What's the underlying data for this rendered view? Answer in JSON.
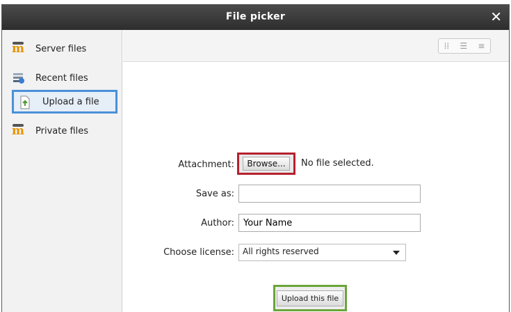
{
  "window": {
    "title": "File picker",
    "close": "✕"
  },
  "sidebar": {
    "items": [
      {
        "label": "Server files",
        "icon": "moodle-icon"
      },
      {
        "label": "Recent files",
        "icon": "recent-files-icon"
      },
      {
        "label": "Upload a file",
        "icon": "upload-icon",
        "selected": true
      },
      {
        "label": "Private files",
        "icon": "moodle-icon"
      }
    ]
  },
  "toolbar": {
    "views": [
      "⁞⁞",
      "☰",
      "≡"
    ]
  },
  "form": {
    "attachment_label": "Attachment:",
    "browse_label": "Browse...",
    "no_file_text": "No file selected.",
    "save_as_label": "Save as:",
    "save_as_value": "",
    "author_label": "Author:",
    "author_value": "Your Name",
    "license_label": "Choose license:",
    "license_value": "All rights reserved",
    "upload_label": "Upload this file"
  },
  "colors": {
    "selected_border": "#4a90d9",
    "browse_highlight": "#b5202e",
    "upload_highlight": "#6aa53a"
  }
}
